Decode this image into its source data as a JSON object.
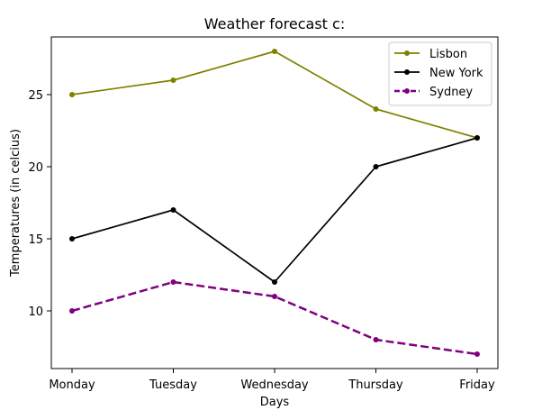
{
  "chart_data": {
    "type": "line",
    "title": "Weather forecast c:",
    "xlabel": "Days",
    "ylabel": "Temperatures (in celcius)",
    "categories": [
      "Monday",
      "Tuesday",
      "Wednesday",
      "Thursday",
      "Friday"
    ],
    "ylim": [
      6,
      29
    ],
    "yticks": [
      10,
      15,
      20,
      25
    ],
    "grid": false,
    "legend_position": "top-right",
    "series": [
      {
        "name": "Lisbon",
        "values": [
          25,
          26,
          28,
          24,
          22
        ],
        "color": "#808000",
        "line_style": "solid",
        "marker": "dot"
      },
      {
        "name": "New York",
        "values": [
          15,
          17,
          12,
          20,
          22
        ],
        "color": "#000000",
        "line_style": "solid",
        "marker": "dot"
      },
      {
        "name": "Sydney",
        "values": [
          10,
          12,
          11,
          8,
          7
        ],
        "color": "#800080",
        "line_style": "dashed",
        "marker": "dot"
      }
    ]
  }
}
